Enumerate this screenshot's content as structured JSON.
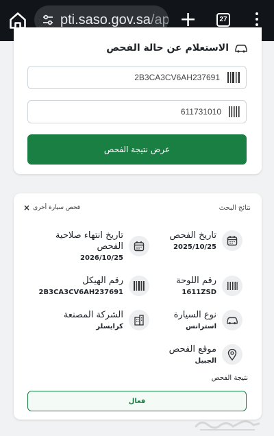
{
  "browser": {
    "url_host": "pti.saso.gov.sa",
    "url_path": "/ap",
    "tab_count": "27"
  },
  "inquiry": {
    "title": "الاستعلام عن حالة الفحص",
    "vin_value": "2B3CA3CV6AH237691",
    "sequence_value": "611731010",
    "submit_label": "عرض نتيجة الفحص"
  },
  "results": {
    "title": "نتائج البحث",
    "search_again_label": "فحص سيارة أخرى",
    "items": {
      "inspection_date": {
        "label": "تاريخ الفحص",
        "value": "2025/10/25",
        "icon": "calendar-icon"
      },
      "expiry_date": {
        "label": "تاريخ انتهاء صلاحية الفحص",
        "value": "2026/10/25",
        "icon": "calendar-icon"
      },
      "plate_number": {
        "label": "رقم اللوحة",
        "value": "1611ZSD",
        "icon": "plate-icon"
      },
      "chassis_number": {
        "label": "رقم الهيكل",
        "value": "2B3CA3CV6AH237691",
        "icon": "barcode-icon"
      },
      "vehicle_type": {
        "label": "نوع السيارة",
        "value": "استرانس",
        "icon": "car-icon"
      },
      "manufacturer": {
        "label": "الشركة المصنعة",
        "value": "كرايسلر",
        "icon": "building-icon"
      },
      "location": {
        "label": "موقع الفحص",
        "value": "الجبيل",
        "icon": "location-pin-icon"
      }
    },
    "result_label": "نتيجة الفحص",
    "result_value": "فعال"
  },
  "colors": {
    "primary_green": "#1a7f42",
    "browser_bar": "#111418"
  }
}
